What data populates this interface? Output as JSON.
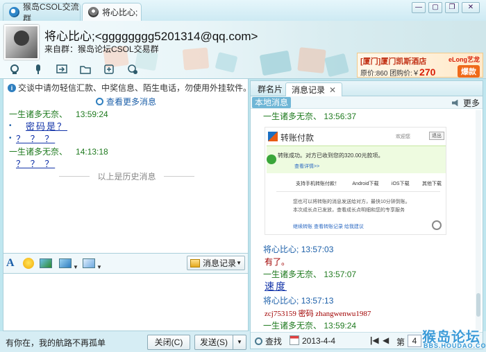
{
  "tabs": [
    {
      "label": "猴岛CSOL交流群"
    },
    {
      "label": "将心比心;"
    }
  ],
  "window_controls": {
    "minimize": "—",
    "maximize": "▢",
    "restore": "❐",
    "close": "✕"
  },
  "header": {
    "contact_name": "将心比心;<gggggggg5201314@qq.com>",
    "contact_group": "来自群：猴岛论坛CSOL交易群"
  },
  "ad": {
    "line1": "[厦门]厦门凯斯酒店",
    "line2_prefix": "原价:860 团购价:￥",
    "price": "270",
    "badge": "爆款",
    "logo": "eLong艺龙"
  },
  "chat": {
    "notice": "交谈中请勿轻信汇款、中奖信息、陌生电话，勿使用外挂软件。",
    "more_messages": "查看更多消息",
    "messages": [
      {
        "sender": "一生诸多无奈、",
        "time": "13:59:24",
        "lines": [
          "密码是？",
          "？ ？ ？"
        ]
      },
      {
        "sender": "一生诸多无奈、",
        "time": "14:13:18",
        "lines": [
          "？ ？ ？"
        ]
      }
    ],
    "history_divider": "以上是历史消息"
  },
  "format_toolbar": {
    "font_glyph": "A",
    "history_button": "消息记录"
  },
  "bottom": {
    "signature": "有你在，我的航路不再孤单",
    "close_button": "关闭(C)",
    "send_button": "发送(S)"
  },
  "right_panel": {
    "tab_members": "群名片",
    "tab_history": "消息记录",
    "local_messages": "本地消息",
    "more": "更多",
    "entries": [
      {
        "sender": "一生诸多无奈、",
        "time": "13:56:37"
      },
      {
        "sender": "将心比心;",
        "time": "13:57:03",
        "text": "有了。"
      },
      {
        "sender": "一生诸多无奈、",
        "time": "13:57:07"
      },
      {
        "sender": "将心比心;",
        "time": "13:57:13",
        "text": "zcj753159  密码  zhangwenwu1987"
      },
      {
        "sender": "一生诸多无奈、",
        "time": "13:59:24"
      }
    ],
    "link_text": "速度",
    "embed": {
      "title": "转账付款",
      "user": "欢迎您",
      "exit": "退出",
      "success": "转账成功。对方已收到您的320.00元款项。",
      "detail": "查看详情>>",
      "links": [
        "支持手机转账付款！",
        "Android下载",
        "iOS下载",
        "其他下载"
      ],
      "note1": "您也可以将转账的消息发送给对方，最快10分钟到账。",
      "note2": "本次成长点已发放，查看成长点明细和您的专享服务",
      "actions": "继续转账  查看转账记录  给我建议"
    },
    "search": "查找",
    "date": "2013-4-4",
    "page_label": "第",
    "page_value": "4"
  },
  "watermark": {
    "text": "猴岛论坛",
    "url": "BBS.HOUDAO.COM"
  },
  "colors": {
    "green_sender": "#1f7a1f",
    "blue_sender": "#1a5ea8",
    "message_blue": "#1233a8",
    "accent": "#3b9bd8"
  },
  "icons": [
    "video-icon",
    "mic-icon",
    "share-icon",
    "folder-icon",
    "app-icon",
    "more-icon"
  ]
}
